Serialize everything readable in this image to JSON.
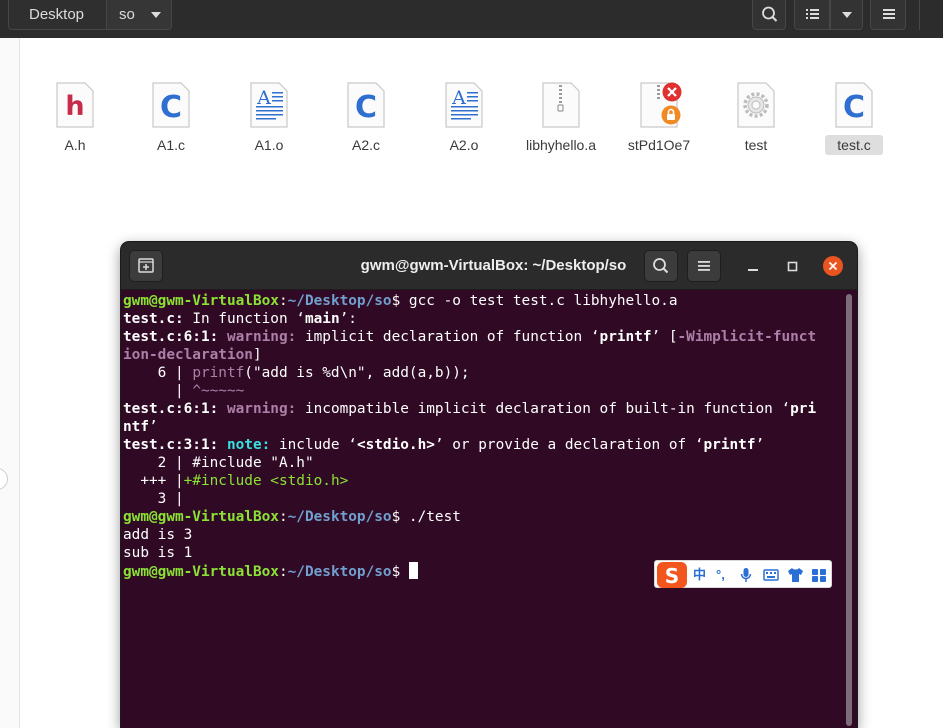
{
  "header": {
    "breadcrumbs": [
      "Desktop",
      "so"
    ]
  },
  "files": [
    {
      "name": "A.h",
      "icon": "c-header-file-icon"
    },
    {
      "name": "A1.c",
      "icon": "c-source-file-icon"
    },
    {
      "name": "A1.o",
      "icon": "object-file-icon"
    },
    {
      "name": "A2.c",
      "icon": "c-source-file-icon"
    },
    {
      "name": "A2.o",
      "icon": "object-file-icon"
    },
    {
      "name": "libhyhello.a",
      "icon": "archive-file-icon"
    },
    {
      "name": "stPd1Oe7",
      "icon": "locked-broken-file-icon"
    },
    {
      "name": "test",
      "icon": "executable-file-icon"
    },
    {
      "name": "test.c",
      "icon": "c-source-file-icon",
      "selected": true
    }
  ],
  "terminal": {
    "title": "gwm@gwm-VirtualBox: ~/Desktop/so",
    "prompt_user": "gwm@gwm-VirtualBox",
    "prompt_colon": ":",
    "prompt_path": "~/Desktop/so",
    "prompt_dollar": "$",
    "cmd1": " gcc -o test test.c libhyhello.a",
    "l2a": "test.c:",
    "l2b": " In function ‘",
    "l2c": "main",
    "l2d": "’:",
    "l3a": "test.c:6:1: ",
    "l3b": "warning: ",
    "l3c": "implicit declaration of function ‘",
    "l3d": "printf",
    "l3e": "’ [",
    "l3f": "-Wimplicit-funct",
    "l4a": "ion-declaration",
    "l4b": "]",
    "l5a": "    6 | ",
    "l5b": "printf",
    "l5c": "(\"add is %d\\n\", add(a,b));",
    "l6a": "      | ",
    "l6b": "^~~~~~",
    "l7a": "test.c:6:1: ",
    "l7b": "warning: ",
    "l7c": "incompatible implicit declaration of built-in function ‘",
    "l7d": "pri",
    "l8a": "ntf",
    "l8b": "’",
    "l9a": "test.c:3:1: ",
    "l9b": "note: ",
    "l9c": "include ‘",
    "l9d": "<stdio.h>",
    "l9e": "’ or provide a declaration of ‘",
    "l9f": "printf",
    "l9g": "’",
    "l10": "    2 | #include \"A.h\"",
    "l11a": "  +++ |",
    "l11b": "+#include <stdio.h>",
    "l12": "    3 |",
    "cmd2": " ./test",
    "out1": "add is 3",
    "out2": "sub is 1"
  },
  "ime": {
    "logo": "S",
    "mode": "中",
    "punct": "°,"
  },
  "colors": {
    "terminal_bg": "#300a24",
    "prompt_green": "#8ae234",
    "prompt_blue": "#729fcf",
    "warning_magenta": "#ad7fa8",
    "note_cyan": "#34e2e2",
    "close_orange": "#e95420"
  }
}
